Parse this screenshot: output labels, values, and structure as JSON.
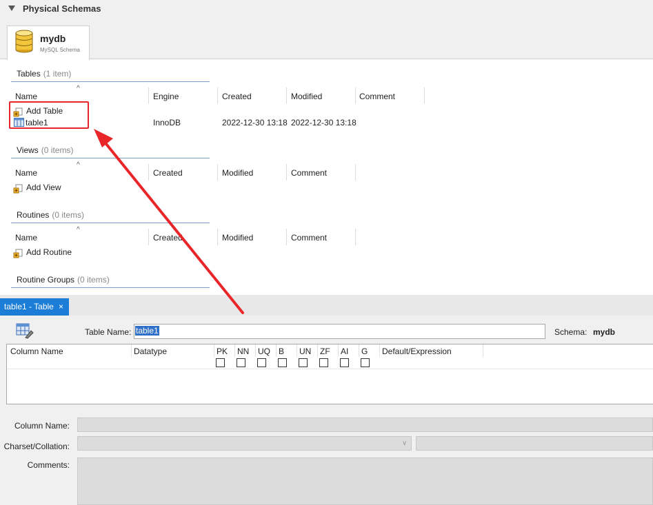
{
  "physical_schemas": {
    "title": "Physical Schemas",
    "schema_tab": {
      "name": "mydb",
      "subtitle": "MySQL Schema"
    }
  },
  "tables": {
    "title": "Tables",
    "count": "(1 item)",
    "columns": [
      "Name",
      "Engine",
      "Created",
      "Modified",
      "Comment"
    ],
    "add_label": "Add Table",
    "rows": [
      {
        "name": "table1",
        "engine": "InnoDB",
        "created": "2022-12-30 13:18",
        "modified": "2022-12-30 13:18",
        "comment": ""
      }
    ]
  },
  "views": {
    "title": "Views",
    "count": "(0 items)",
    "columns": [
      "Name",
      "Created",
      "Modified",
      "Comment"
    ],
    "add_label": "Add View"
  },
  "routines": {
    "title": "Routines",
    "count": "(0 items)",
    "columns": [
      "Name",
      "Created",
      "Modified",
      "Comment"
    ],
    "add_label": "Add Routine"
  },
  "routine_groups": {
    "title": "Routine Groups",
    "count": "(0 items)"
  },
  "editor": {
    "tab_label": "table1 - Table",
    "close_glyph": "×",
    "table_name_label": "Table Name:",
    "table_name_value": "table1",
    "schema_label": "Schema:",
    "schema_value": "mydb",
    "grid_columns": {
      "column_name": "Column Name",
      "datatype": "Datatype",
      "flags": [
        "PK",
        "NN",
        "UQ",
        "B",
        "UN",
        "ZF",
        "AI",
        "G"
      ],
      "default": "Default/Expression"
    },
    "column_name_label": "Column Name:",
    "charset_label": "Charset/Collation:",
    "comments_label": "Comments:"
  },
  "colors": {
    "accent": "#1c7dd6",
    "highlight": "#e8262a",
    "selection": "#3070c8"
  }
}
